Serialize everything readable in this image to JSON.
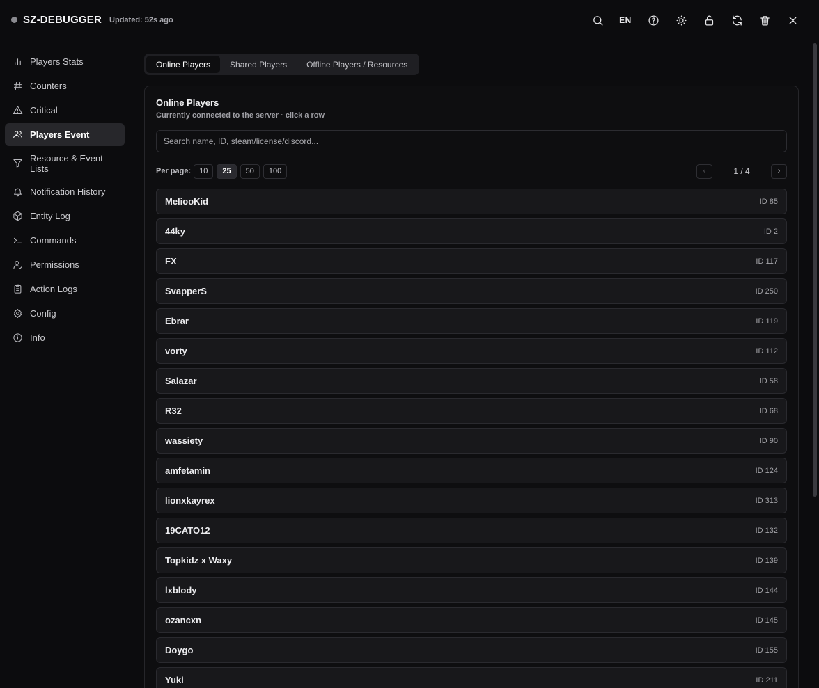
{
  "header": {
    "app_title": "SZ-DEBUGGER",
    "updated_text": "Updated: 52s ago",
    "lang_label": "EN",
    "actions": [
      "search-icon",
      "help-icon",
      "sun-icon",
      "unlock-icon",
      "refresh-icon",
      "trash-icon",
      "close-icon"
    ]
  },
  "sidebar": {
    "items": [
      {
        "label": "Players Stats",
        "icon": "bar-chart-icon"
      },
      {
        "label": "Counters",
        "icon": "hash-icon"
      },
      {
        "label": "Critical",
        "icon": "warning-icon"
      },
      {
        "label": "Players Event",
        "icon": "users-icon",
        "active": true
      },
      {
        "label": "Resource & Event Lists",
        "icon": "filter-icon"
      },
      {
        "label": "Notification History",
        "icon": "bell-icon"
      },
      {
        "label": "Entity Log",
        "icon": "cube-icon"
      },
      {
        "label": "Commands",
        "icon": "terminal-icon"
      },
      {
        "label": "Permissions",
        "icon": "user-check-icon"
      },
      {
        "label": "Action Logs",
        "icon": "clipboard-icon"
      },
      {
        "label": "Config",
        "icon": "gear-icon"
      },
      {
        "label": "Info",
        "icon": "info-icon"
      }
    ]
  },
  "tabs": [
    {
      "label": "Online Players",
      "active": true
    },
    {
      "label": "Shared Players"
    },
    {
      "label": "Offline Players / Resources"
    }
  ],
  "card": {
    "title": "Online Players",
    "subtitle": "Currently connected to the server · click a row",
    "search_placeholder": "Search name, ID, steam/license/discord..."
  },
  "per_page": {
    "label": "Per page:",
    "options": [
      "10",
      "25",
      "50",
      "100"
    ],
    "selected": "25"
  },
  "pagination": {
    "prev_label": "‹",
    "next_label": "›",
    "page_text": "1 / 4"
  },
  "players": [
    {
      "name": "MeliooKid",
      "id": "ID 85"
    },
    {
      "name": "44ky",
      "id": "ID 2"
    },
    {
      "name": "FX",
      "id": "ID 117"
    },
    {
      "name": "SvapperS",
      "id": "ID 250"
    },
    {
      "name": "Ebrar",
      "id": "ID 119"
    },
    {
      "name": "vorty",
      "id": "ID 112"
    },
    {
      "name": "Salazar",
      "id": "ID 58"
    },
    {
      "name": "R32",
      "id": "ID 68"
    },
    {
      "name": "wassiety",
      "id": "ID 90"
    },
    {
      "name": "amfetamin",
      "id": "ID 124"
    },
    {
      "name": "lionxkayrex",
      "id": "ID 313"
    },
    {
      "name": "19CATO12",
      "id": "ID 132"
    },
    {
      "name": "Topkidz x Waxy",
      "id": "ID 139"
    },
    {
      "name": "lxblody",
      "id": "ID 144"
    },
    {
      "name": "ozancxn",
      "id": "ID 145"
    },
    {
      "name": "Doygo",
      "id": "ID 155"
    },
    {
      "name": "Yuki",
      "id": "ID 211"
    }
  ]
}
